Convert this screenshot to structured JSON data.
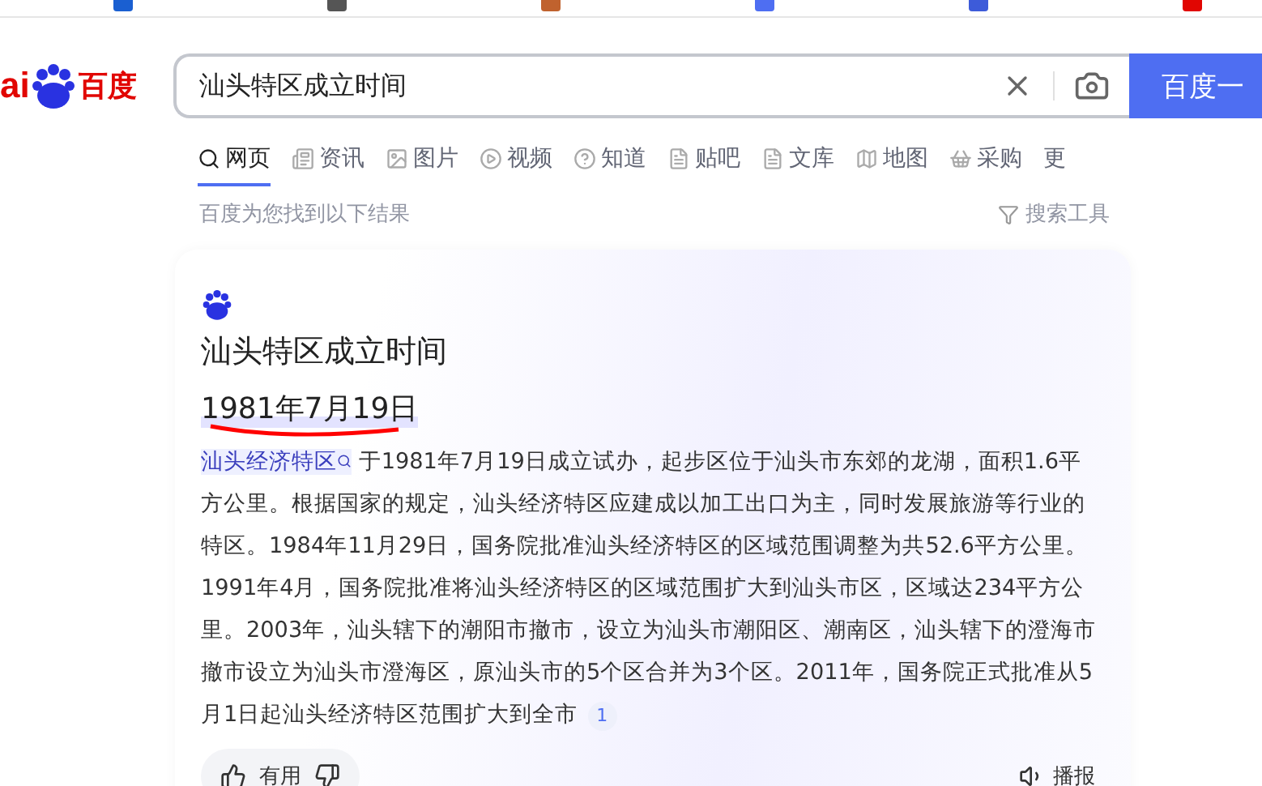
{
  "logo": {
    "text_latin": "ai",
    "text_cn": "百度"
  },
  "search": {
    "value": "汕头特区成立时间",
    "button": "百度一"
  },
  "tabs": [
    {
      "label": "网页",
      "selected": true,
      "kind": "search"
    },
    {
      "label": "资讯",
      "selected": false,
      "kind": "news"
    },
    {
      "label": "图片",
      "selected": false,
      "kind": "image"
    },
    {
      "label": "视频",
      "selected": false,
      "kind": "video"
    },
    {
      "label": "知道",
      "selected": false,
      "kind": "question"
    },
    {
      "label": "贴吧",
      "selected": false,
      "kind": "tieba"
    },
    {
      "label": "文库",
      "selected": false,
      "kind": "doc"
    },
    {
      "label": "地图",
      "selected": false,
      "kind": "map"
    },
    {
      "label": "采购",
      "selected": false,
      "kind": "basket"
    },
    {
      "label": "更",
      "selected": false,
      "kind": "more"
    }
  ],
  "result_info": "百度为您找到以下结果",
  "search_tools": "搜索工具",
  "answer": {
    "title": "汕头特区成立时间",
    "date": "1981年7月19日",
    "link": "汕头经济特区",
    "text": " 于1981年7月19日成立试办，起步区位于汕头市东郊的龙湖，面积1.6平方公里。根据国家的规定，汕头经济特区应建成以加工出口为主，同时发展旅游等行业的特区。1984年11月29日，国务院批准汕头经济特区的区域范围调整为共52.6平方公里。1991年4月，国务院批准将汕头经济特区的区域范围扩大到汕头市区，区域达234平方公里。2003年，汕头辖下的潮阳市撤市，设立为汕头市潮阳区、潮南区，汕头辖下的澄海市撤市设立为汕头市澄海区，原汕头市的5个区合并为3个区。2011年，国务院正式批准从5月1日起汕头经济特区范围扩大到全市",
    "citation": "1",
    "useful": "有用",
    "read_aloud": "播报"
  }
}
